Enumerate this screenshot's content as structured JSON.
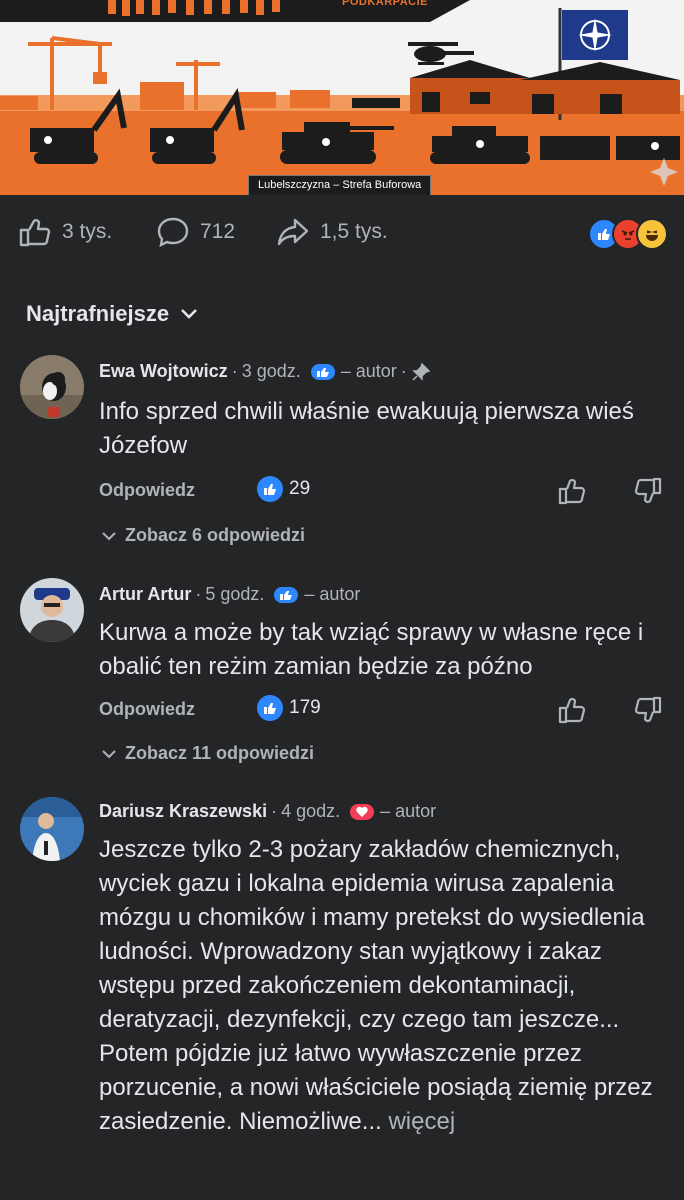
{
  "banner": {
    "brand": "PODKARPACIE",
    "caption": "Lubelszczyzna – Strefa Buforowa",
    "colors": {
      "orange": "#e9712b",
      "dark": "#1c1c1c",
      "nato_blue": "#1f3a8a"
    }
  },
  "stats": {
    "likes": "3 tys.",
    "comments": "712",
    "shares": "1,5 tys.",
    "reaction_icons": [
      "like-icon",
      "angry-icon",
      "haha-icon"
    ]
  },
  "sort": {
    "label": "Najtrafniejsze"
  },
  "comments": [
    {
      "author": "Ewa Wojtowicz",
      "time": "3 godz.",
      "badge": "like-badge-icon",
      "author_tag": "– autor",
      "pinned": true,
      "text": "Info sprzed chwili właśnie ewakuują pierwsza wieś Józefow",
      "reply": "Odpowiedz",
      "likes": "29",
      "see_replies": "Zobacz 6 odpowiedzi"
    },
    {
      "author": "Artur Artur",
      "time": "5 godz.",
      "badge": "like-badge-icon",
      "author_tag": "– autor",
      "text": "Kurwa a może by tak wziąć sprawy w własne ręce i obalić ten reżim zamian będzie za późno",
      "reply": "Odpowiedz",
      "likes": "179",
      "see_replies": "Zobacz 11 odpowiedzi"
    },
    {
      "author": "Dariusz Kraszewski",
      "time": "4 godz.",
      "badge": "love-badge-icon",
      "author_tag": "– autor",
      "text": "Jeszcze tylko 2-3 pożary zakładów chemicznych, wyciek gazu i lokalna epidemia wirusa zapalenia mózgu u chomików i mamy pretekst do wysiedlenia ludności. Wprowadzony stan wyjątkowy i zakaz wstępu przed zakończeniem dekontaminacji, deratyzacji, dezynfekcji, czy czego tam jeszcze... Potem pójdzie już łatwo wywłaszczenie przez porzucenie, a nowi właściciele posiądą ziemię przez zasiedzenie. Niemożliwe...",
      "more": "więcej"
    }
  ]
}
